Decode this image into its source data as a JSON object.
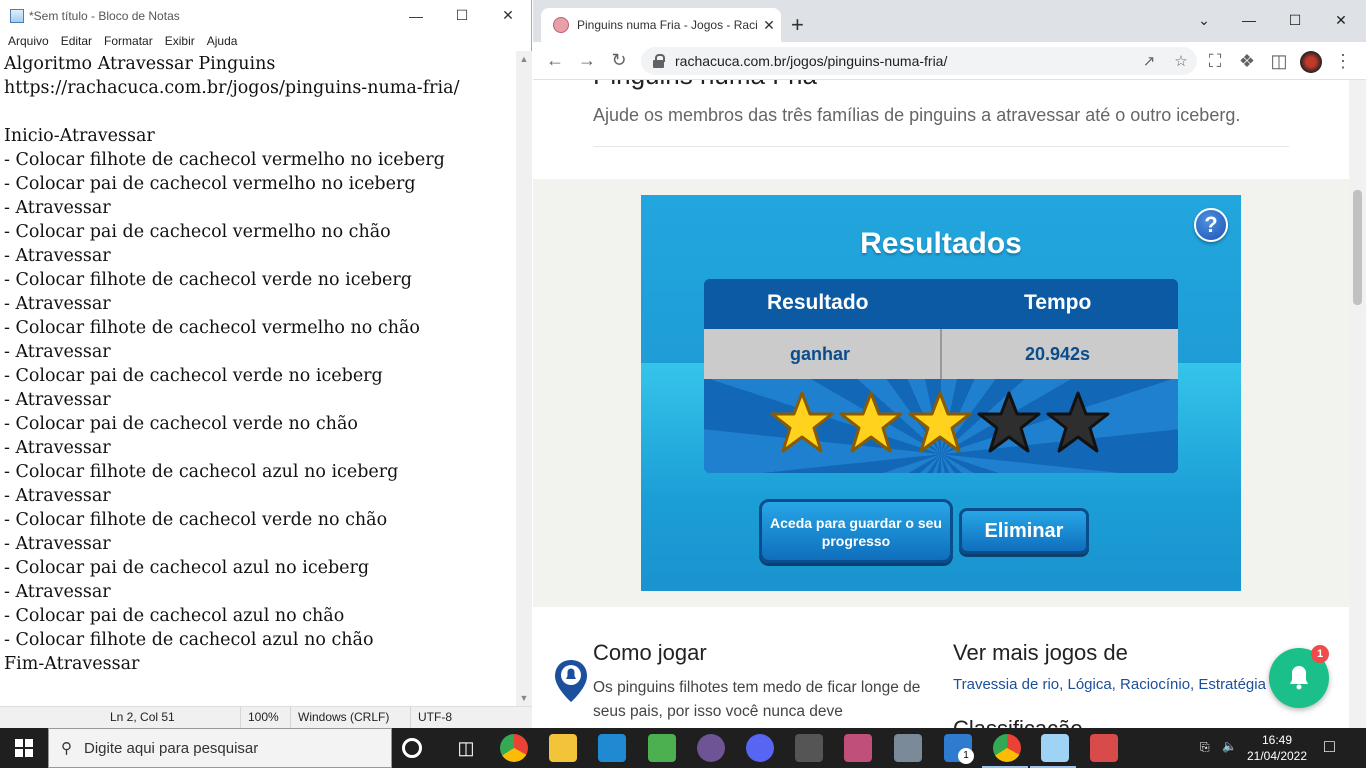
{
  "notepad": {
    "title": "*Sem título - Bloco de Notas",
    "menu": [
      "Arquivo",
      "Editar",
      "Formatar",
      "Exibir",
      "Ajuda"
    ],
    "content": "Algoritmo Atravessar Pinguins\nhttps://rachacuca.com.br/jogos/pinguins-numa-fria/\n\nInicio-Atravessar\n- Colocar filhote de cachecol vermelho no iceberg\n- Colocar pai de cachecol vermelho no iceberg\n- Atravessar\n- Colocar pai de cachecol vermelho no chão\n- Atravessar\n- Colocar filhote de cachecol verde no iceberg\n- Atravessar\n- Colocar filhote de cachecol vermelho no chão\n- Atravessar\n- Colocar pai de cachecol verde no iceberg\n- Atravessar\n- Colocar pai de cachecol verde no chão\n- Atravessar\n- Colocar filhote de cachecol azul no iceberg\n- Atravessar\n- Colocar filhote de cachecol verde no chão\n- Atravessar\n- Colocar pai de cachecol azul no iceberg\n- Atravessar\n- Colocar pai de cachecol azul no chão\n- Colocar filhote de cachecol azul no chão\nFim-Atravessar",
    "status": {
      "position": "Ln 2, Col 51",
      "zoom": "100%",
      "line_ending": "Windows (CRLF)",
      "encoding": "UTF-8"
    }
  },
  "browser": {
    "tab_title": "Pinguins numa Fria - Jogos - Raci",
    "url": "rachacuca.com.br/jogos/pinguins-numa-fria/"
  },
  "page": {
    "heading": "Pinguins numa Fria",
    "description": "Ajude os membros das três famílias de pinguins a atravessar até o outro iceberg.",
    "game": {
      "title": "Resultados",
      "help": "?",
      "col_result": "Resultado",
      "col_time": "Tempo",
      "result": "ganhar",
      "time": "20.942s",
      "stars_earned": 3,
      "stars_total": 5,
      "login_button": "Aceda para guardar o seu progresso",
      "eliminate_button": "Eliminar"
    },
    "howto_title": "Como jogar",
    "howto_text": "Os pinguins filhotes tem medo de ficar longe de seus pais, por isso você nunca deve",
    "more_title": "Ver mais jogos de",
    "more_links": "Travessia de rio, Lógica, Raciocínio, Estratégia",
    "classification_title": "Classificação",
    "notification_count": "1"
  },
  "taskbar": {
    "search_placeholder": "Digite aqui para pesquisar",
    "time": "16:49",
    "date": "21/04/2022",
    "badge": "1"
  },
  "colors": {
    "game_blue": "#1e9cd6",
    "star_gold": "#ffd21e",
    "notif_green": "#1bbf8a"
  }
}
